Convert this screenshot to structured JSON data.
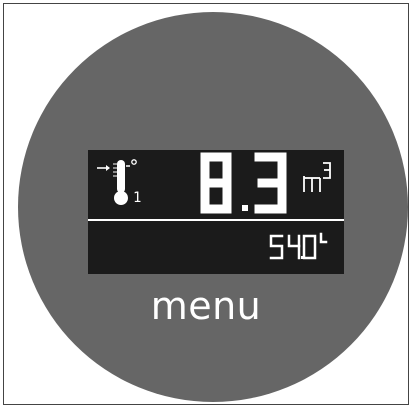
{
  "display": {
    "main_value": "8.3",
    "main_unit": "m³",
    "secondary_value": "54.0",
    "secondary_unit": "L",
    "sensor_index": "1",
    "temperature_marker": "°"
  },
  "menu": {
    "label": "menu"
  },
  "icons": {
    "temperature": "thermometer-icon",
    "arrow": "arrow-right-icon"
  },
  "colors": {
    "dial": "#666666",
    "lcd": "#1b1b1b",
    "text": "#ffffff"
  }
}
